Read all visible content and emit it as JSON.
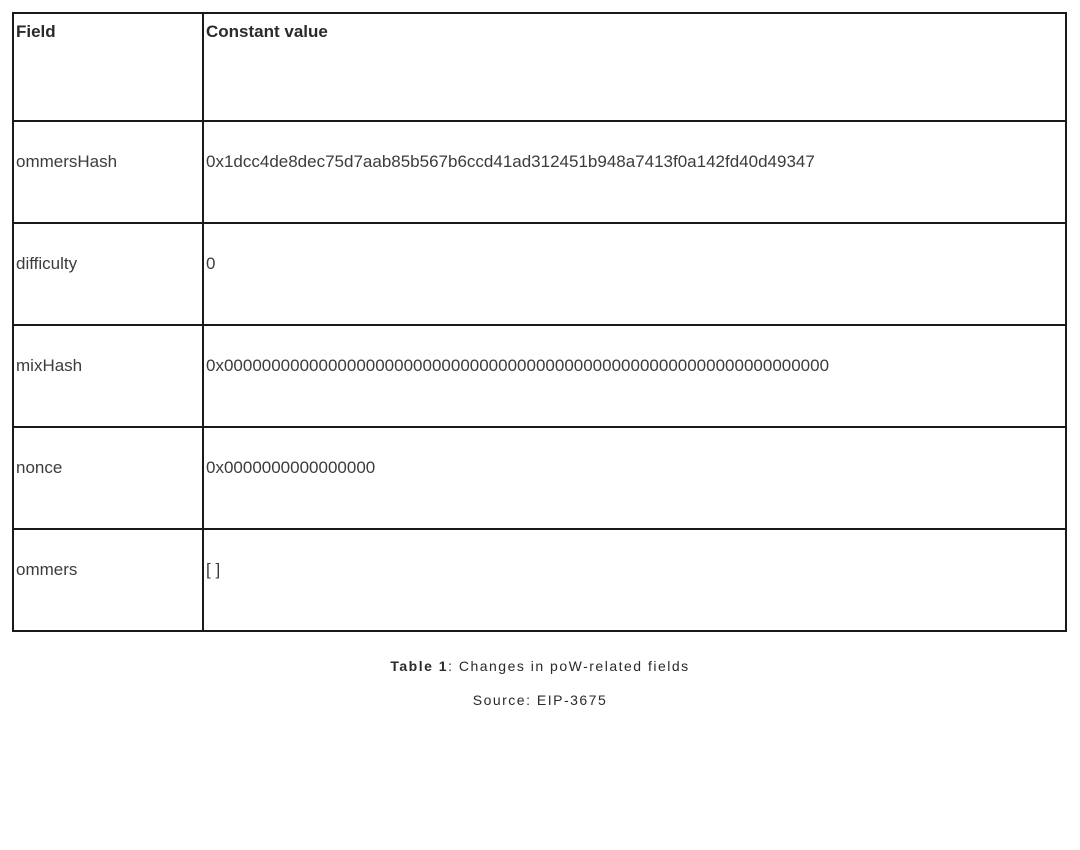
{
  "table": {
    "headers": {
      "field": "Field",
      "value": "Constant value"
    },
    "rows": [
      {
        "field": "ommersHash",
        "value": "0x1dcc4de8dec75d7aab85b567b6ccd41ad312451b948a7413f0a142fd40d49347"
      },
      {
        "field": "difficulty",
        "value": "0"
      },
      {
        "field": "mixHash",
        "value": "0x0000000000000000000000000000000000000000000000000000000000000000"
      },
      {
        "field": "nonce",
        "value": "0x0000000000000000"
      },
      {
        "field": "ommers",
        "value": "[ ]"
      }
    ]
  },
  "caption": {
    "label": "Table 1",
    "text": ": Changes in poW-related fields"
  },
  "source": "Source: EIP-3675"
}
